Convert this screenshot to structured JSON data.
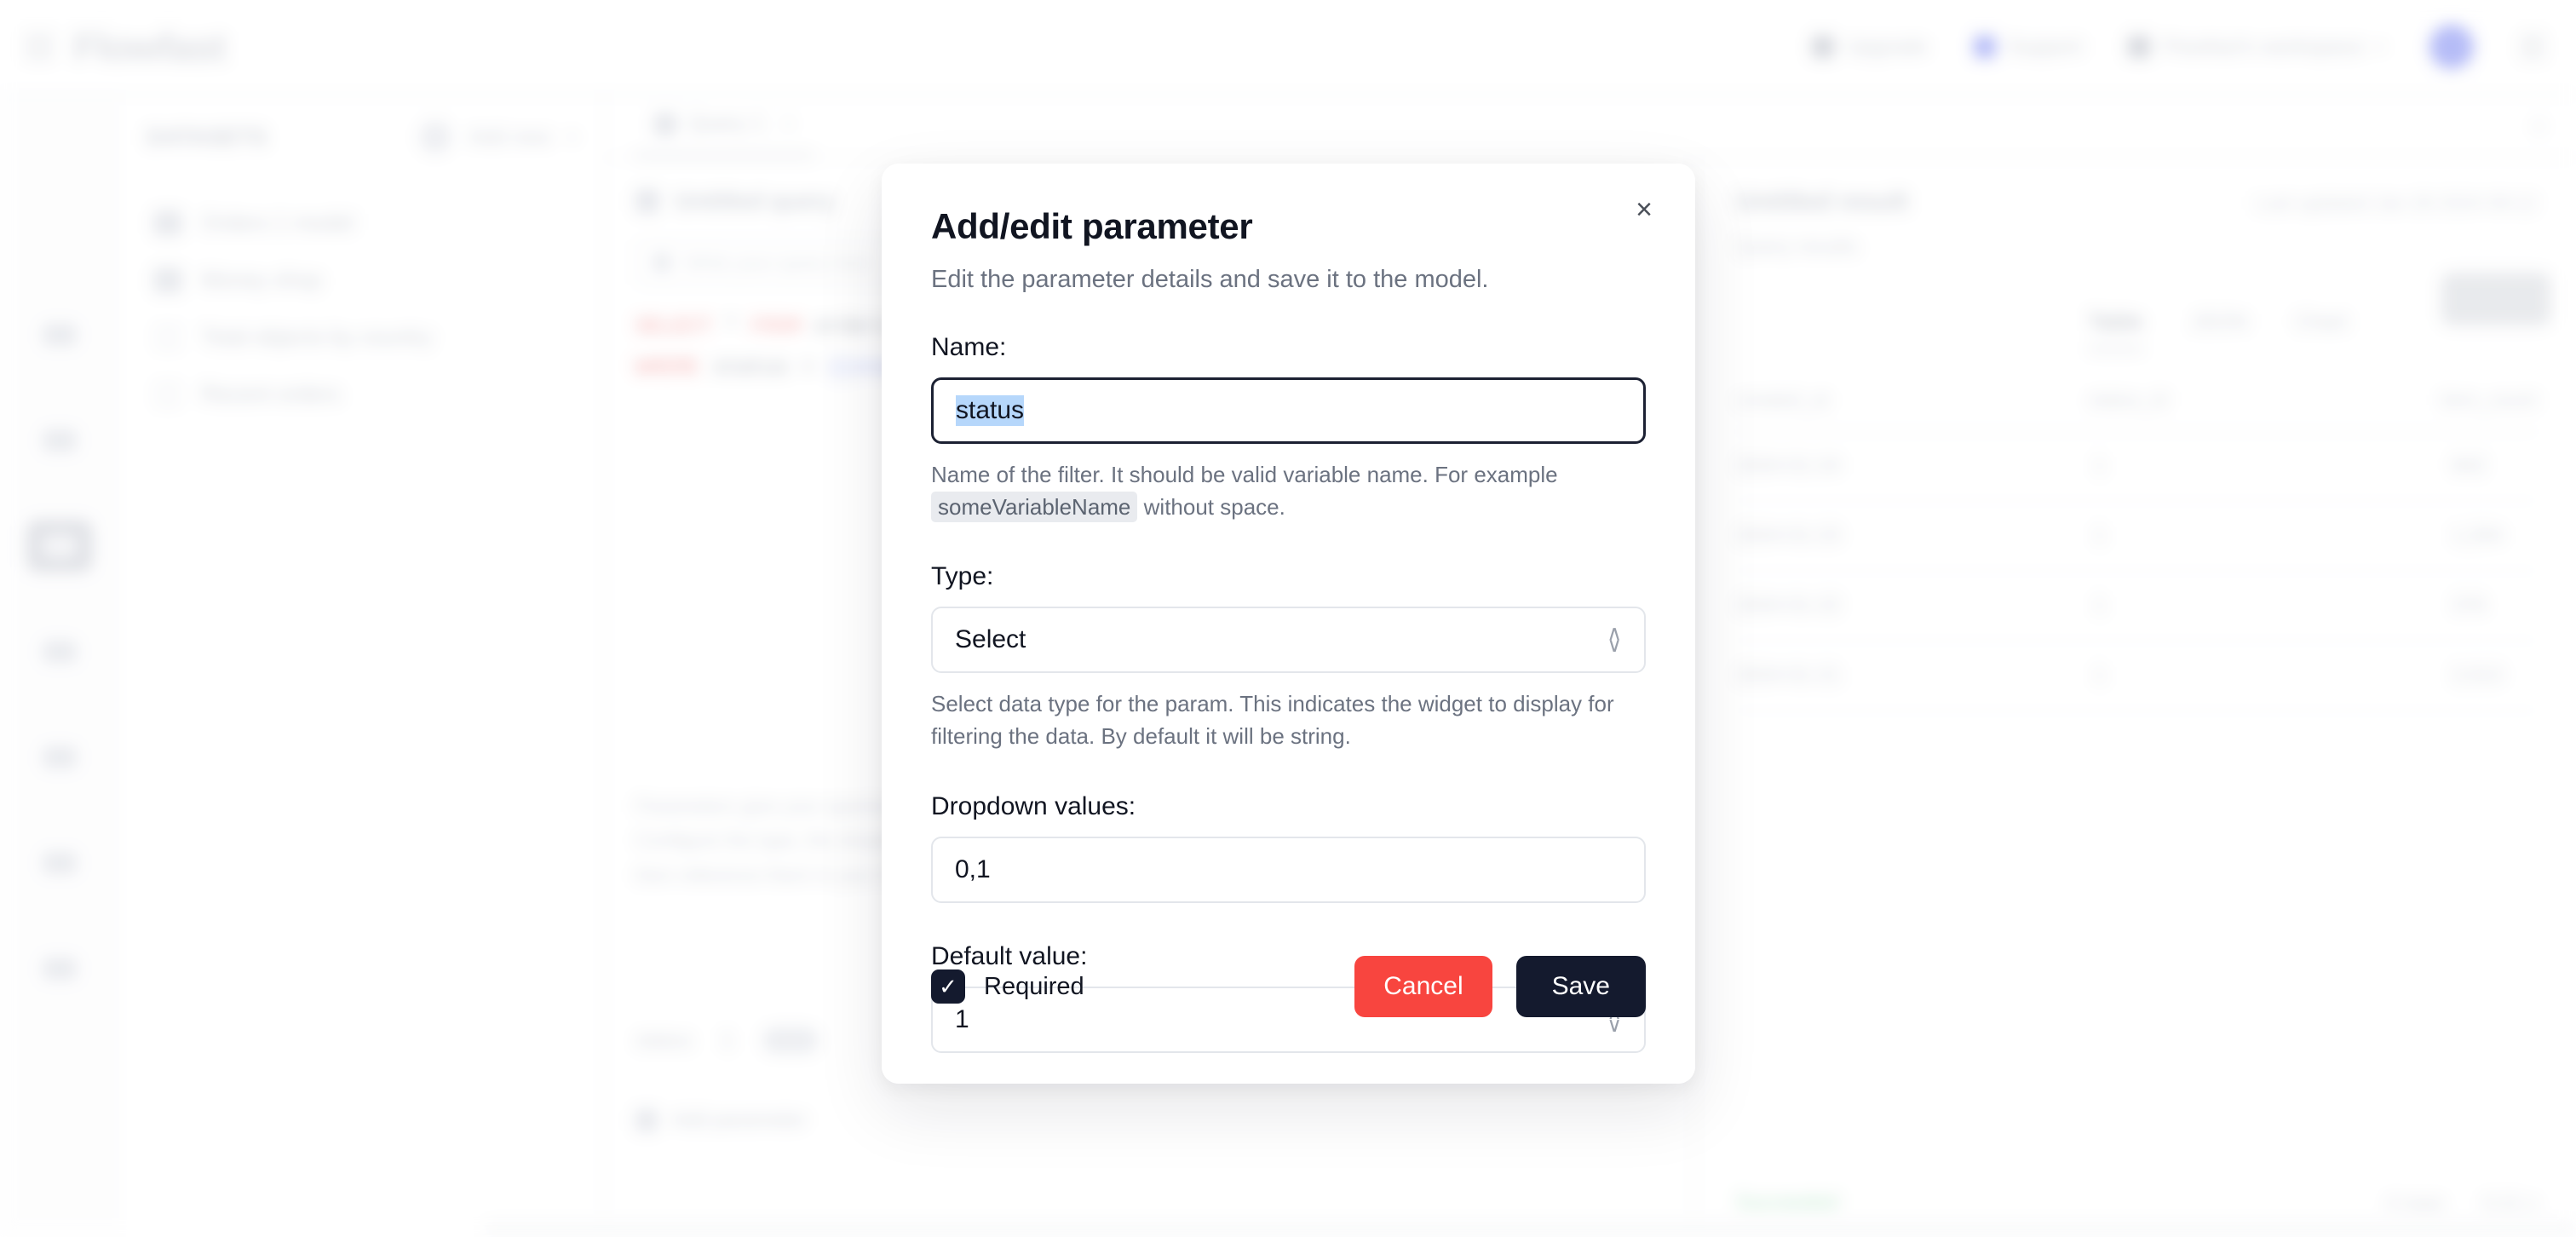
{
  "app": {
    "brand": "Flowfast",
    "topbar_items": [
      {
        "label": "Upgrade",
        "icon": "arrow-up-icon",
        "tone": "dark"
      },
      {
        "label": "Support",
        "icon": "lifebuoy-icon",
        "tone": "blue"
      },
      {
        "label": "Flowfast's workspace",
        "icon": "workspace-icon",
        "tone": "dark",
        "chevron": "▾"
      }
    ],
    "hamburger_icon": "hamburger-icon",
    "avatar_icon": "user-avatar",
    "menu_icon": "overflow-menu-icon"
  },
  "rail": {
    "items": [
      {
        "name": "home-icon",
        "active": false
      },
      {
        "name": "edit-icon",
        "active": false
      },
      {
        "name": "query-icon",
        "active": true
      },
      {
        "name": "table-icon",
        "active": false
      },
      {
        "name": "layers-icon",
        "active": false
      },
      {
        "name": "cloud-icon",
        "active": false
      },
      {
        "name": "help-icon",
        "active": false
      }
    ]
  },
  "sidebar": {
    "title": "DATASETS",
    "circle_icon": "sort-icon",
    "action_label": "Add new",
    "action_chevron": "▾",
    "items": [
      {
        "label": "Orders 1 model",
        "icon": "grid-icon"
      },
      {
        "label": "Money shop",
        "icon": "grid-icon"
      },
      {
        "label": "Total objects by country",
        "icon": "line-icon"
      },
      {
        "label": "Recent orders",
        "icon": "line-icon"
      }
    ]
  },
  "main": {
    "tabs": [
      {
        "label": "Query 1",
        "icon": "query-tab-icon",
        "close": "×",
        "active": true
      }
    ],
    "close_all": "×",
    "save_button": "Save"
  },
  "editor": {
    "header_title": "Untitled query",
    "header_icon": "search-icon",
    "search_placeholder": "Write your query here",
    "search_icon": "magnify-icon",
    "sql_lines": [
      {
        "tokens": [
          {
            "t": "SELECT",
            "k": "kw"
          },
          {
            "t": " * ",
            "k": "idt"
          },
          {
            "t": "FROM",
            "k": "kw2"
          },
          {
            "t": " orders ",
            "k": "idt"
          }
        ]
      },
      {
        "tokens": [
          {
            "t": "WHERE",
            "k": "kw"
          },
          {
            "t": " status = ",
            "k": "idt"
          },
          {
            "t": "{{status}}",
            "k": "num"
          },
          {
            "t": ";",
            "k": "idt"
          }
        ]
      }
    ],
    "note": "Parameters give your queries dynamic inputs. Configure the type, the dropdown values and a default, then reference them in your SQL.",
    "param_label": "status",
    "param_value": "1",
    "add_param_label": "Add parameter",
    "add_param_icon": "plus-icon"
  },
  "results": {
    "title": "Untitled result",
    "meta": "Last updated Jan 28 2024 09:12",
    "subtitle": "Query results",
    "tabs": [
      {
        "label": "Table",
        "active": true
      },
      {
        "label": "JSON",
        "active": false
      },
      {
        "label": "Chart",
        "active": false
      }
    ],
    "columns": [
      "created_at",
      "status_id",
      "item_count"
    ],
    "rows": [
      [
        "2024-01-24",
        "1",
        "842"
      ],
      [
        "2024-01-23",
        "1",
        "1,204"
      ],
      [
        "2024-01-22",
        "1",
        "376"
      ],
      [
        "2024-01-21",
        "1",
        "2,013"
      ]
    ],
    "status": "Succeeded",
    "footer_items": [
      "4 rows",
      "0.21 s"
    ]
  },
  "modal": {
    "title": "Add/edit parameter",
    "subtitle": "Edit the parameter details and save it to the model.",
    "close_icon": "close-icon",
    "close_glyph": "×",
    "name": {
      "label": "Name:",
      "value": "status",
      "help_prefix": "Name of the filter. It should be valid variable name. For example",
      "help_code": "someVariableName",
      "help_suffix": "without space."
    },
    "type": {
      "label": "Type:",
      "value": "Select",
      "stepper_up": "∧",
      "stepper_down": "∨",
      "help": "Select data type for the param. This indicates the widget to display for filtering the data. By default it will be string."
    },
    "dropdown_values": {
      "label": "Dropdown values:",
      "value": "0,1"
    },
    "default_value": {
      "label": "Default value:",
      "value": "1",
      "stepper_up": "∧",
      "stepper_down": "∨"
    },
    "required": {
      "label": "Required",
      "checked": true,
      "check_glyph": "✓"
    },
    "cancel_label": "Cancel",
    "save_label": "Save"
  },
  "colors": {
    "accent_dark": "#141a2e",
    "danger": "#f8453f",
    "selection": "#b6d7fb",
    "success": "#8fd6a8",
    "code_chip_bg": "#e9ebef"
  }
}
